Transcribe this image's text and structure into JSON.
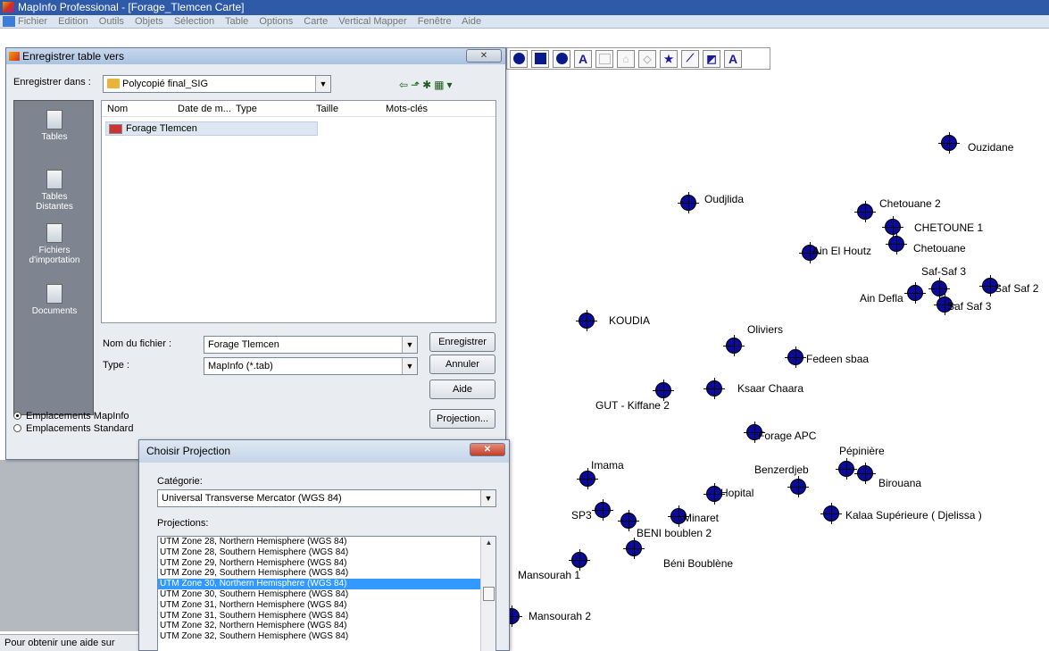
{
  "app": {
    "title": "MapInfo Professional - [Forage_Tlemcen Carte]"
  },
  "menubar": {
    "items": [
      "Fichier",
      "Edition",
      "Outils",
      "Objets",
      "Sélection",
      "Table",
      "Options",
      "Carte",
      "Vertical Mapper",
      "Fenêtre",
      "Aide"
    ]
  },
  "toolbar": {
    "text_tool": "A",
    "label_tool": "A"
  },
  "save_dialog": {
    "title": "Enregistrer table vers",
    "close": "✕",
    "save_in_label": "Enregistrer dans :",
    "folder": "Polycopié final_SIG",
    "places": [
      "Tables",
      "Tables\nDistantes",
      "Fichiers\nd'importation",
      "Documents"
    ],
    "columns": [
      "Nom",
      "Date de m...",
      "Type",
      "Taille",
      "Mots-clés"
    ],
    "files": [
      "Forage Tlemcen"
    ],
    "filename_label": "Nom du fichier :",
    "filename_value": "Forage Tlemcen",
    "type_label": "Type :",
    "type_value": "MapInfo (*.tab)",
    "save_button": "Enregistrer",
    "cancel_button": "Annuler",
    "help_button": "Aide",
    "projection_button": "Projection...",
    "radio_mapinfo": "Emplacements MapInfo",
    "radio_standard": "Emplacements Standard"
  },
  "projection_dialog": {
    "title": "Choisir Projection",
    "close": "✕",
    "category_label": "Catégorie:",
    "category_value": "Universal Transverse Mercator (WGS 84)",
    "projections_label": "Projections:",
    "projections": [
      "UTM Zone 28, Northern Hemisphere (WGS 84)",
      "UTM Zone 28, Southern Hemisphere (WGS 84)",
      "UTM Zone 29, Northern Hemisphere (WGS 84)",
      "UTM Zone 29, Southern Hemisphere (WGS 84)",
      "UTM Zone 30, Northern Hemisphere (WGS 84)",
      "UTM Zone 30, Southern Hemisphere (WGS 84)",
      "UTM Zone 31, Northern Hemisphere (WGS 84)",
      "UTM Zone 31, Southern Hemisphere (WGS 84)",
      "UTM Zone 32, Northern Hemisphere (WGS 84)",
      "UTM Zone 32, Southern Hemisphere (WGS 84)"
    ],
    "selected_index": 4
  },
  "status": {
    "text": "Pour obtenir une aide sur"
  },
  "map": {
    "points": [
      {
        "label": "Ouzidane"
      },
      {
        "label": "Oudjlida"
      },
      {
        "label": "Chetouane 2"
      },
      {
        "label": "CHETOUNE 1"
      },
      {
        "label": "Chetouane"
      },
      {
        "label": "Ain El Houtz"
      },
      {
        "label": "Saf-Saf 3"
      },
      {
        "label": "Saf Saf 2"
      },
      {
        "label": "Ain Defla"
      },
      {
        "label": "Saf Saf 3"
      },
      {
        "label": "KOUDIA"
      },
      {
        "label": "Oliviers"
      },
      {
        "label": "Fedeen sbaa"
      },
      {
        "label": "Ksaar Chaara"
      },
      {
        "label": "GUT - Kiffane 2"
      },
      {
        "label": "Forage APC"
      },
      {
        "label": "Pépinière"
      },
      {
        "label": "Benzerdjeb"
      },
      {
        "label": "Birouana"
      },
      {
        "label": "Imama"
      },
      {
        "label": "Hopital"
      },
      {
        "label": "SP3"
      },
      {
        "label": "Minaret"
      },
      {
        "label": "BENI boublen 2"
      },
      {
        "label": "Kalaa Supérieure ( Djelissa )"
      },
      {
        "label": "Béni Boublène"
      },
      {
        "label": "Mansourah 1"
      },
      {
        "label": "Mansourah 2"
      }
    ]
  }
}
